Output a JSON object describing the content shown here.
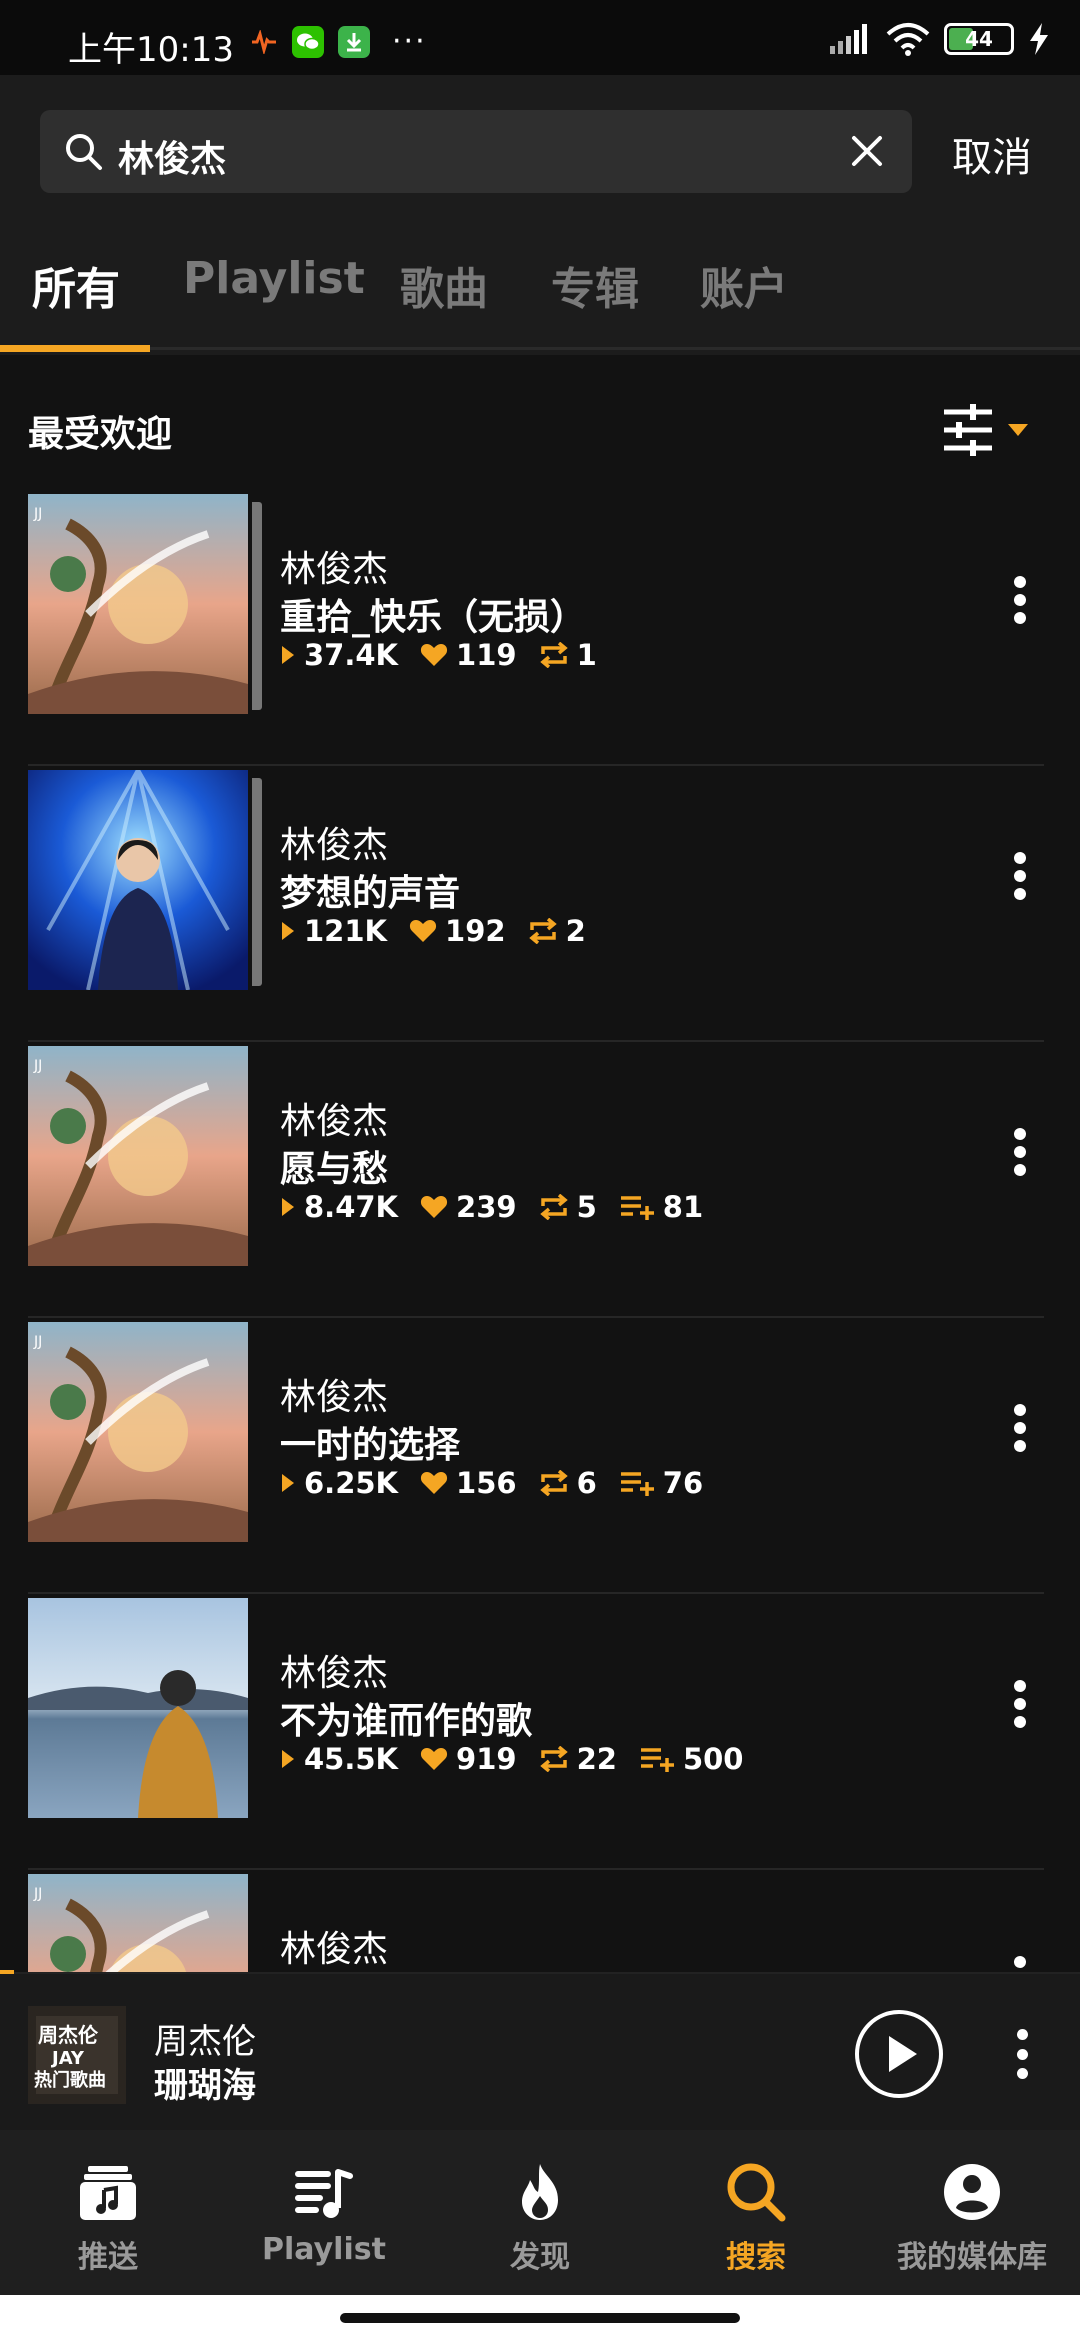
{
  "status_bar": {
    "time": "上午10:13",
    "battery": "44",
    "dots": "···"
  },
  "search": {
    "query": "林俊杰",
    "cancel_label": "取消"
  },
  "tabs": [
    {
      "label": "所有",
      "active": true
    },
    {
      "label": "Playlist",
      "active": false
    },
    {
      "label": "歌曲",
      "active": false
    },
    {
      "label": "专辑",
      "active": false
    },
    {
      "label": "账户",
      "active": false
    }
  ],
  "section": {
    "title": "最受欢迎"
  },
  "results": [
    {
      "artist": "林俊杰",
      "title": "重拾_快乐（无损）",
      "plays": "37.4K",
      "likes": "119",
      "reposts": "1",
      "adds": null,
      "cover": "jj-album",
      "stacked": true
    },
    {
      "artist": "林俊杰",
      "title": "梦想的声音",
      "plays": "121K",
      "likes": "192",
      "reposts": "2",
      "adds": null,
      "cover": "stage",
      "stacked": true
    },
    {
      "artist": "林俊杰",
      "title": "愿与愁",
      "plays": "8.47K",
      "likes": "239",
      "reposts": "5",
      "adds": "81",
      "cover": "jj-album",
      "stacked": false
    },
    {
      "artist": "林俊杰",
      "title": "一时的选择",
      "plays": "6.25K",
      "likes": "156",
      "reposts": "6",
      "adds": "76",
      "cover": "jj-album",
      "stacked": false
    },
    {
      "artist": "林俊杰",
      "title": "不为谁而作的歌",
      "plays": "45.5K",
      "likes": "919",
      "reposts": "22",
      "adds": "500",
      "cover": "lake",
      "stacked": false
    },
    {
      "artist": "林俊杰",
      "title": "",
      "plays": "",
      "likes": "",
      "reposts": "",
      "adds": null,
      "cover": "jj-album",
      "stacked": false
    }
  ],
  "mini_player": {
    "artist": "周杰伦",
    "title": "珊瑚海",
    "cover_text_1": "周杰伦",
    "cover_text_2": "JAY",
    "cover_text_3": "热门歌曲"
  },
  "bottom_nav": [
    {
      "label": "推送",
      "icon": "feed-icon",
      "active": false
    },
    {
      "label": "Playlist",
      "icon": "playlist-icon",
      "active": false
    },
    {
      "label": "发现",
      "icon": "fire-icon",
      "active": false
    },
    {
      "label": "搜索",
      "icon": "search-icon",
      "active": true
    },
    {
      "label": "我的媒体库",
      "icon": "account-icon",
      "active": false
    }
  ],
  "colors": {
    "accent": "#f5a623",
    "background": "#121212",
    "header": "#1c1c1c"
  }
}
